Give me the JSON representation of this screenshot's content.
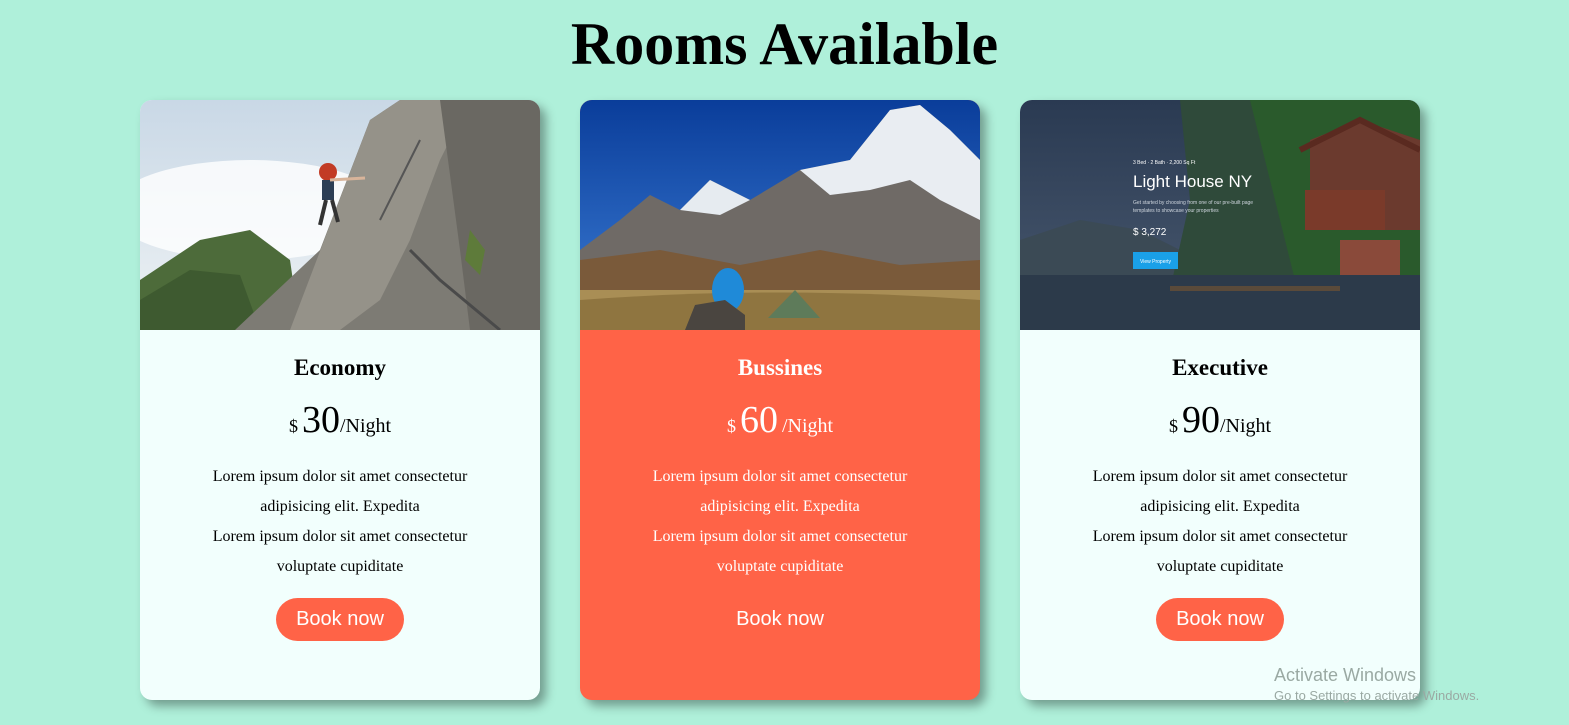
{
  "page": {
    "title": "Rooms Available"
  },
  "rooms": [
    {
      "name": "Economy",
      "currency": "$",
      "price": "30",
      "unit": "/Night",
      "desc_lines": [
        "Lorem ipsum dolor sit amet consectetur",
        "adipisicing elit. Expedita",
        "Lorem ipsum dolor sit amet consectetur",
        "voluptate cupiditate"
      ],
      "button": "Book now",
      "image": "rock-climber-photo"
    },
    {
      "name": "Bussines",
      "currency": "$",
      "price": "60",
      "unit": "/Night",
      "desc_lines": [
        "Lorem ipsum dolor sit amet consectetur",
        "adipisicing elit. Expedita",
        "Lorem ipsum dolor sit amet consectetur",
        "voluptate cupiditate"
      ],
      "button": "Book now",
      "image": "mountain-camp-photo"
    },
    {
      "name": "Executive",
      "currency": "$",
      "price": "90",
      "unit": "/Night",
      "desc_lines": [
        "Lorem ipsum dolor sit amet consectetur",
        "adipisicing elit. Expedita",
        "Lorem ipsum dolor sit amet consectetur",
        "voluptate cupiditate"
      ],
      "button": "Book now",
      "image": "lake-house-photo",
      "image_text": {
        "meta": "3 Bed · 2 Bath · 2,200 Sq Ft",
        "title": "Light House NY",
        "blurb1": "Get started by choosing from one of our pre-built page",
        "blurb2": "templates to showcase your properties",
        "price": "$ 3,272",
        "cta": "View Property"
      }
    }
  ],
  "watermark": {
    "line1": "Activate Windows",
    "line2": "Go to Settings to activate Windows."
  },
  "colors": {
    "background": "#aff0da",
    "accent": "#ff6347",
    "card": "#f2fffd"
  }
}
